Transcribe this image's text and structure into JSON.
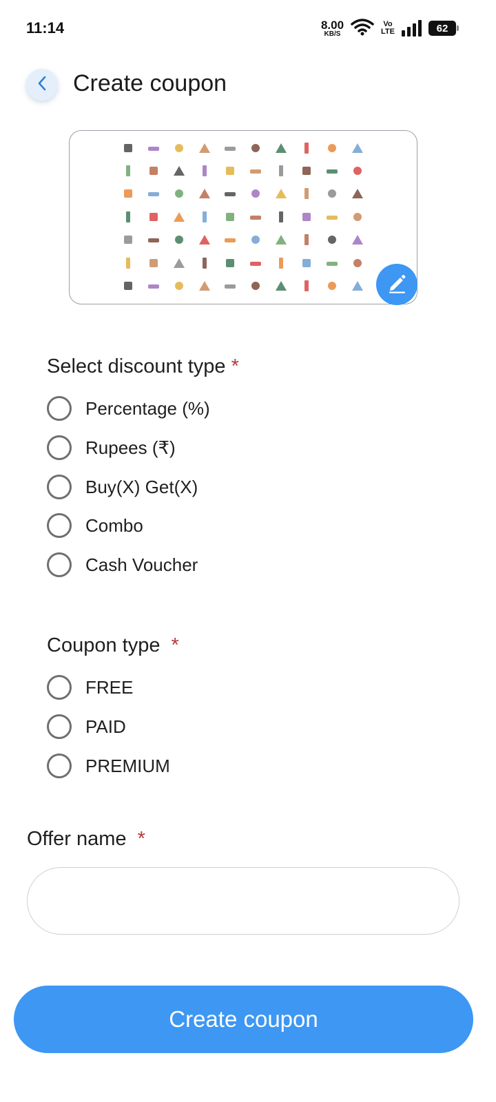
{
  "status_bar": {
    "time": "11:14",
    "net_speed_value": "8.00",
    "net_speed_unit": "KB/S",
    "volte_top": "Vo",
    "volte_bottom": "LTE",
    "battery": "62"
  },
  "header": {
    "back_icon": "chevron-left-icon",
    "title": "Create coupon"
  },
  "coupon_image": {
    "edit_icon": "pencil-icon",
    "accent_color": "#3d97f3"
  },
  "discount_type": {
    "label": "Select discount type",
    "required_mark": "*",
    "options": [
      "Percentage (%)",
      "Rupees (₹)",
      "Buy(X) Get(X)",
      "Combo",
      "Cash Voucher"
    ]
  },
  "coupon_type": {
    "label": "Coupon type",
    "required_mark": "*",
    "options": [
      "FREE",
      "PAID",
      "PREMIUM"
    ]
  },
  "offer_name": {
    "label": "Offer name",
    "required_mark": "*",
    "value": "",
    "placeholder": ""
  },
  "submit": {
    "label": "Create coupon"
  }
}
